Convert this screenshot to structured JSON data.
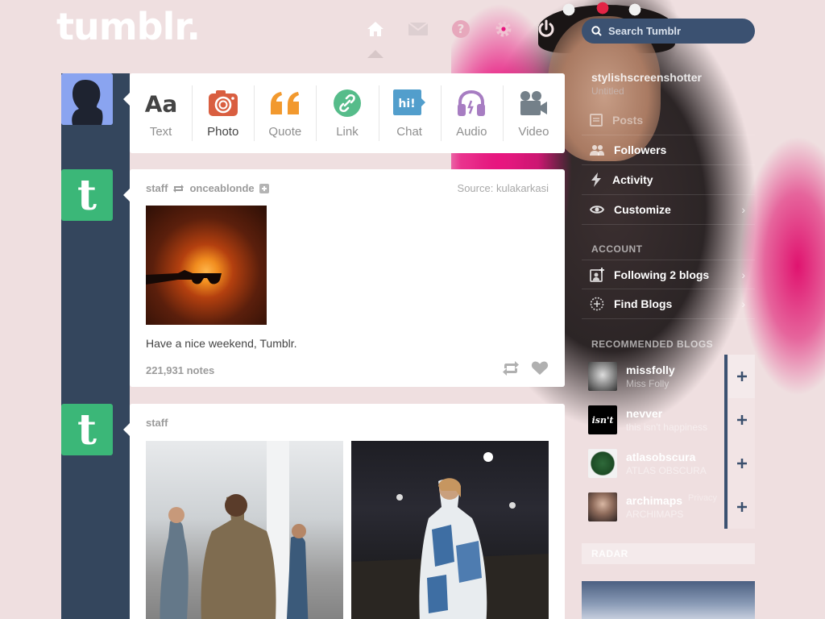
{
  "app": {
    "logo": "tumblr.",
    "accent": "#34465d",
    "brand_green": "#3bb778"
  },
  "header": {
    "nav": [
      {
        "icon": "home-icon",
        "label": "Dashboard"
      },
      {
        "icon": "mail-icon",
        "label": "Inbox"
      },
      {
        "icon": "help-icon",
        "label": "Help"
      },
      {
        "icon": "gear-icon",
        "label": "Settings"
      },
      {
        "icon": "power-icon",
        "label": "Log out"
      }
    ],
    "search": {
      "placeholder": "Search Tumblr",
      "value": ""
    }
  },
  "post_types": [
    {
      "label": "Text",
      "icon": "text-icon",
      "color": "#444444"
    },
    {
      "label": "Photo",
      "icon": "camera-icon",
      "color": "#d95e40"
    },
    {
      "label": "Quote",
      "icon": "quote-icon",
      "color": "#f2992e"
    },
    {
      "label": "Link",
      "icon": "link-icon",
      "color": "#56bc8a"
    },
    {
      "label": "Chat",
      "icon": "chat-icon",
      "color": "#529ecc"
    },
    {
      "label": "Audio",
      "icon": "headphones-icon",
      "color": "#a77dc2"
    },
    {
      "label": "Video",
      "icon": "video-camera-icon",
      "color": "#748089"
    }
  ],
  "posts": [
    {
      "author": "staff",
      "reblogged_from": "onceablonde",
      "source_label": "Source:",
      "source": "kulakarkasi",
      "caption": "Have a nice weekend, Tumblr.",
      "notes": "221,931 notes"
    },
    {
      "author": "staff"
    }
  ],
  "sidebar": {
    "blog_name": "stylishscreenshotter",
    "blog_sub": "Untitled",
    "items": [
      {
        "label": "Posts",
        "icon": "posts-icon"
      },
      {
        "label": "Followers",
        "icon": "followers-icon"
      },
      {
        "label": "Activity",
        "icon": "lightning-icon"
      },
      {
        "label": "Customize",
        "icon": "eye-icon"
      }
    ],
    "account_heading": "ACCOUNT",
    "account_items": [
      {
        "label": "Following 2 blogs",
        "icon": "add-person-icon"
      },
      {
        "label": "Find Blogs",
        "icon": "compass-icon"
      }
    ],
    "recommended_heading": "RECOMMENDED BLOGS",
    "recommended": [
      {
        "name": "missfolly",
        "sub": "Miss Folly"
      },
      {
        "name": "nevver",
        "sub": "this isn't happiness"
      },
      {
        "name": "atlasobscura",
        "sub": "ATLAS OBSCURA"
      },
      {
        "name": "archimaps",
        "sub": "ARCHIMAPS"
      }
    ],
    "privacy": "Privacy",
    "radar_heading": "RADAR"
  }
}
